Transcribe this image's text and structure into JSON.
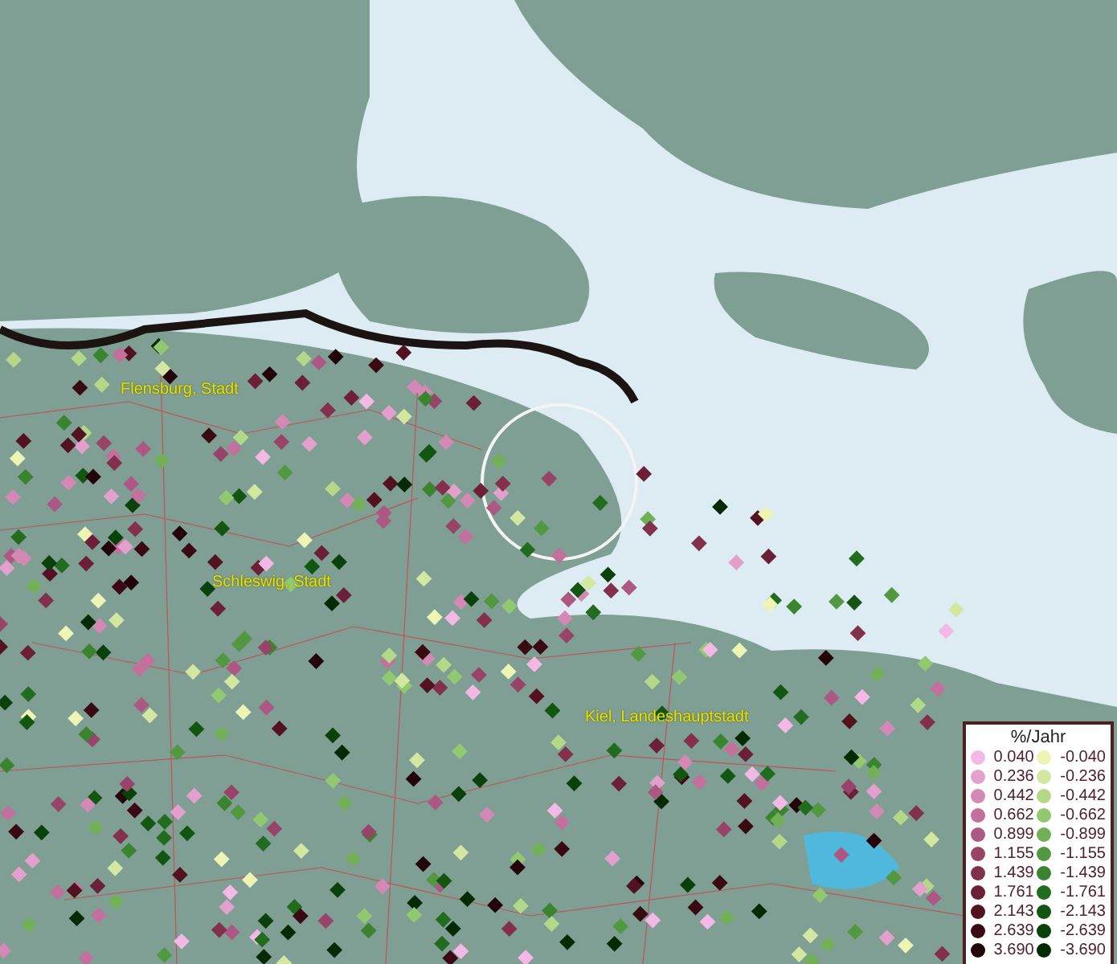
{
  "map": {
    "places": [
      {
        "name": "Flensburg, Stadt"
      },
      {
        "name": "Schleswig, Stadt"
      },
      {
        "name": "Kiel, Landeshauptstadt"
      }
    ]
  },
  "legend": {
    "title": "%/Jahr",
    "positive": [
      {
        "value": "0.040",
        "color": "#f4b8e4"
      },
      {
        "value": "0.236",
        "color": "#e4a0cc"
      },
      {
        "value": "0.442",
        "color": "#d488b4"
      },
      {
        "value": "0.662",
        "color": "#c4709c"
      },
      {
        "value": "0.899",
        "color": "#ac5882"
      },
      {
        "value": "1.155",
        "color": "#984468"
      },
      {
        "value": "1.439",
        "color": "#82304c"
      },
      {
        "value": "1.761",
        "color": "#6c2038"
      },
      {
        "value": "2.143",
        "color": "#521222"
      },
      {
        "value": "2.639",
        "color": "#3a0a14"
      },
      {
        "value": "3.690",
        "color": "#22040a"
      }
    ],
    "negative": [
      {
        "value": "-0.040",
        "color": "#eef4b4"
      },
      {
        "value": "-0.236",
        "color": "#d2e8a0"
      },
      {
        "value": "-0.442",
        "color": "#b2d888"
      },
      {
        "value": "-0.662",
        "color": "#92c870"
      },
      {
        "value": "-0.899",
        "color": "#72b058"
      },
      {
        "value": "-1.155",
        "color": "#529840"
      },
      {
        "value": "-1.439",
        "color": "#3a8430"
      },
      {
        "value": "-1.761",
        "color": "#226c20"
      },
      {
        "value": "-2.143",
        "color": "#125612"
      },
      {
        "value": "-2.639",
        "color": "#0a400a"
      },
      {
        "value": "-3.690",
        "color": "#042a04"
      }
    ]
  }
}
